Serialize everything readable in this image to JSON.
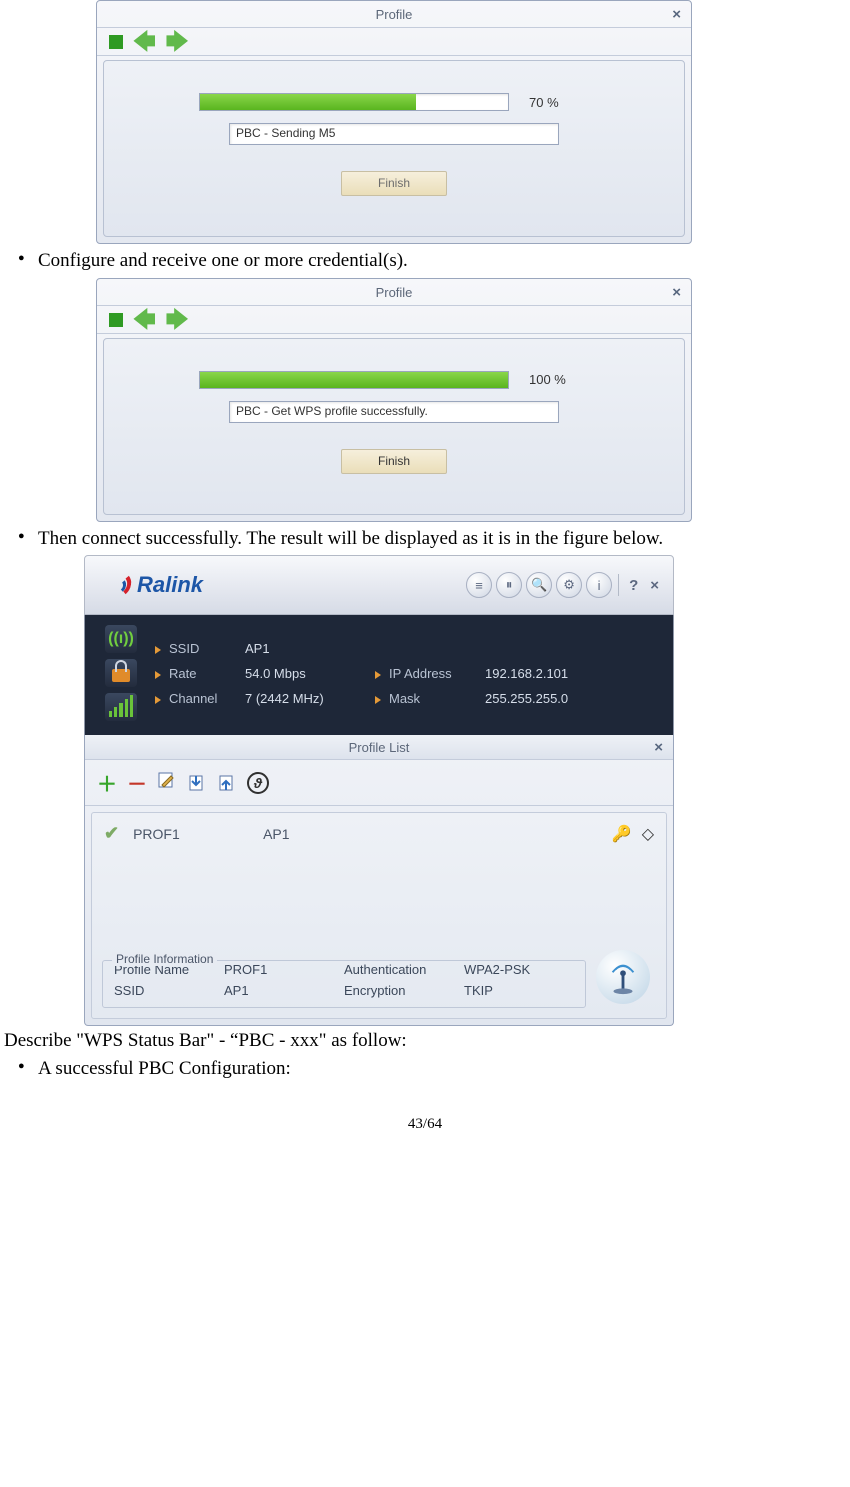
{
  "dialog1": {
    "title": "Profile",
    "progress_pct": 70,
    "progress_label": "70 %",
    "status": "PBC - Sending M5",
    "finish_label": "Finish",
    "finish_enabled": false
  },
  "bullet1": "Configure and receive one or more credential(s).",
  "dialog2": {
    "title": "Profile",
    "progress_pct": 100,
    "progress_label": "100 %",
    "status": "PBC - Get WPS profile successfully.",
    "finish_label": "Finish",
    "finish_enabled": true
  },
  "bullet2": "Then connect successfully. The result will be displayed as it is in the figure below.",
  "ralink": {
    "brand": "Ralink",
    "help_symbol": "?",
    "status": {
      "ssid_label": "SSID",
      "ssid": "AP1",
      "rate_label": "Rate",
      "rate": "54.0 Mbps",
      "channel_label": "Channel",
      "channel": "7 (2442 MHz)",
      "ip_label": "IP Address",
      "ip": "192.168.2.101",
      "mask_label": "Mask",
      "mask": "255.255.255.0"
    },
    "profile_list": {
      "title": "Profile List",
      "row": {
        "name": "PROF1",
        "ap": "AP1"
      },
      "info_title": "Profile Information",
      "profile_name_label": "Profile Name",
      "profile_name": "PROF1",
      "ssid_label": "SSID",
      "ssid_val": "AP1",
      "auth_label": "Authentication",
      "auth_val": "WPA2-PSK",
      "enc_label": "Encryption",
      "enc_val": "TKIP"
    }
  },
  "para_after": "Describe \"WPS Status Bar\" - “PBC - xxx\" as follow:",
  "bullet3": "A successful PBC Configuration:",
  "page_number": "43/64"
}
